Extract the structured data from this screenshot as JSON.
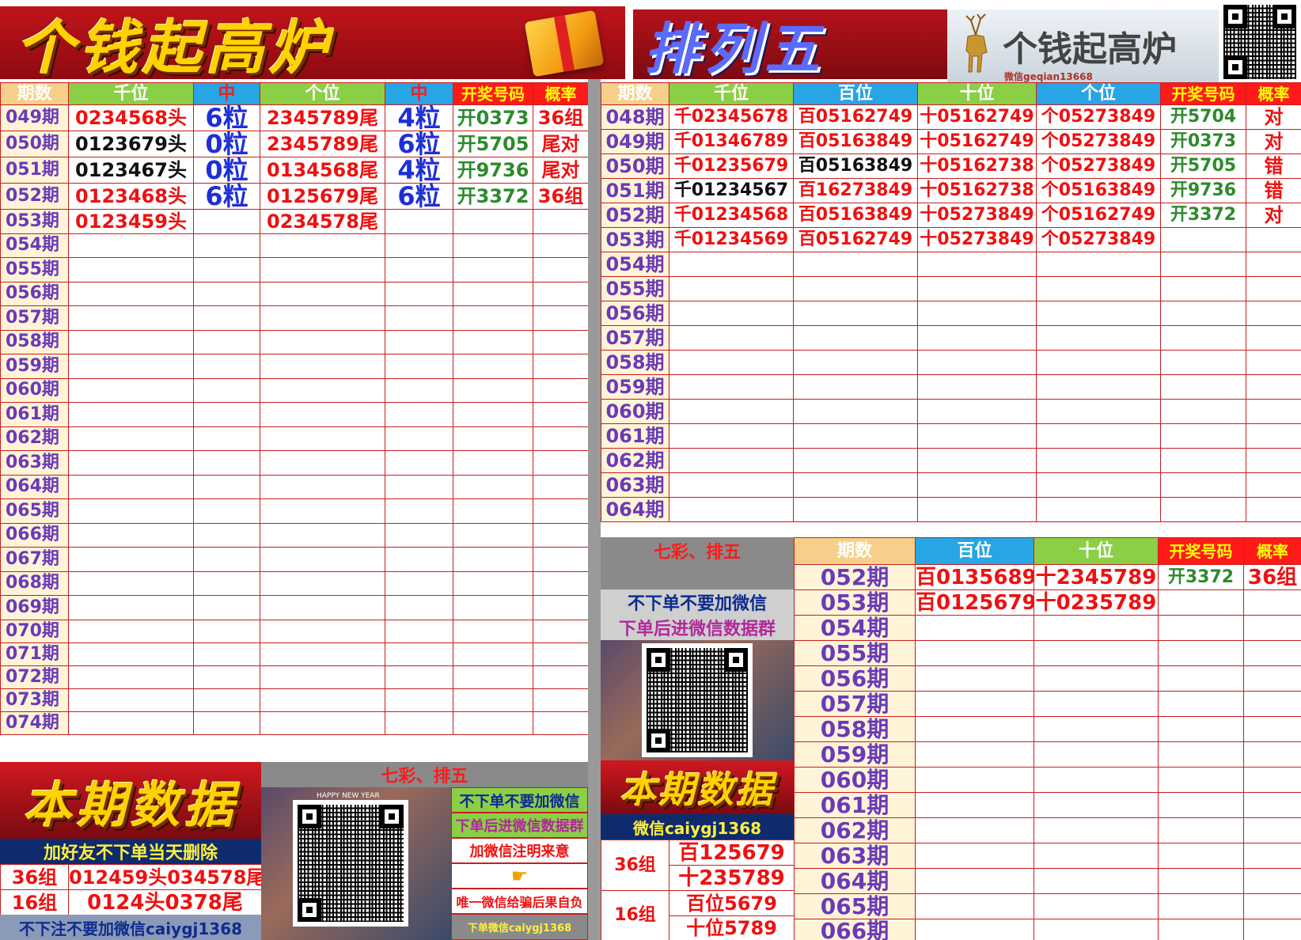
{
  "left_banner": {
    "title": "个钱起高炉"
  },
  "right_banner": {
    "title": "排列五",
    "logo_text": "个钱起高炉",
    "wechat_caption": "微信geqian13668"
  },
  "left_table": {
    "headers": [
      "期数",
      "千位",
      "中",
      "个位",
      "中",
      "开奖号码",
      "概率"
    ],
    "rows": [
      [
        "049期",
        "0234568头",
        "6粒",
        "2345789尾",
        "4粒",
        "开0373",
        "36组"
      ],
      [
        "050期",
        "0123679头",
        "0粒",
        "2345789尾",
        "6粒",
        "开5705",
        "尾对"
      ],
      [
        "051期",
        "0123467头",
        "0粒",
        "0134568尾",
        "4粒",
        "开9736",
        "尾对"
      ],
      [
        "052期",
        "0123468头",
        "6粒",
        "0125679尾",
        "6粒",
        "开3372",
        "36组"
      ],
      [
        "053期",
        "0123459头",
        "",
        "0234578尾",
        "",
        "",
        ""
      ],
      [
        "054期",
        "",
        "",
        "",
        "",
        "",
        ""
      ],
      [
        "055期",
        "",
        "",
        "",
        "",
        "",
        ""
      ],
      [
        "056期",
        "",
        "",
        "",
        "",
        "",
        ""
      ],
      [
        "057期",
        "",
        "",
        "",
        "",
        "",
        ""
      ],
      [
        "058期",
        "",
        "",
        "",
        "",
        "",
        ""
      ],
      [
        "059期",
        "",
        "",
        "",
        "",
        "",
        ""
      ],
      [
        "060期",
        "",
        "",
        "",
        "",
        "",
        ""
      ],
      [
        "061期",
        "",
        "",
        "",
        "",
        "",
        ""
      ],
      [
        "062期",
        "",
        "",
        "",
        "",
        "",
        ""
      ],
      [
        "063期",
        "",
        "",
        "",
        "",
        "",
        ""
      ],
      [
        "064期",
        "",
        "",
        "",
        "",
        "",
        ""
      ],
      [
        "065期",
        "",
        "",
        "",
        "",
        "",
        ""
      ],
      [
        "066期",
        "",
        "",
        "",
        "",
        "",
        ""
      ],
      [
        "067期",
        "",
        "",
        "",
        "",
        "",
        ""
      ],
      [
        "068期",
        "",
        "",
        "",
        "",
        "",
        ""
      ],
      [
        "069期",
        "",
        "",
        "",
        "",
        "",
        ""
      ],
      [
        "070期",
        "",
        "",
        "",
        "",
        "",
        ""
      ],
      [
        "071期",
        "",
        "",
        "",
        "",
        "",
        ""
      ],
      [
        "072期",
        "",
        "",
        "",
        "",
        "",
        ""
      ],
      [
        "073期",
        "",
        "",
        "",
        "",
        "",
        ""
      ],
      [
        "074期",
        "",
        "",
        "",
        "",
        "",
        ""
      ]
    ]
  },
  "right_table": {
    "headers": [
      "期数",
      "千位",
      "百位",
      "十位",
      "个位",
      "开奖号码",
      "概率"
    ],
    "rows": [
      [
        "048期",
        "千02345678",
        "百05162749",
        "十05162749",
        "个05273849",
        "开5704",
        "对"
      ],
      [
        "049期",
        "千01346789",
        "百05163849",
        "十05162749",
        "个05273849",
        "开0373",
        "对"
      ],
      [
        "050期",
        "千01235679",
        "百05163849",
        "十05162738",
        "个05273849",
        "开5705",
        "错"
      ],
      [
        "051期",
        "千01234567",
        "百16273849",
        "十05162738",
        "个05163849",
        "开9736",
        "错"
      ],
      [
        "052期",
        "千01234568",
        "百05163849",
        "十05273849",
        "个05162749",
        "开3372",
        "对"
      ],
      [
        "053期",
        "千01234569",
        "百05162749",
        "十05273849",
        "个05273849",
        "",
        ""
      ],
      [
        "054期",
        "",
        "",
        "",
        "",
        "",
        ""
      ],
      [
        "055期",
        "",
        "",
        "",
        "",
        "",
        ""
      ],
      [
        "056期",
        "",
        "",
        "",
        "",
        "",
        ""
      ],
      [
        "057期",
        "",
        "",
        "",
        "",
        "",
        ""
      ],
      [
        "058期",
        "",
        "",
        "",
        "",
        "",
        ""
      ],
      [
        "059期",
        "",
        "",
        "",
        "",
        "",
        ""
      ],
      [
        "060期",
        "",
        "",
        "",
        "",
        "",
        ""
      ],
      [
        "061期",
        "",
        "",
        "",
        "",
        "",
        ""
      ],
      [
        "062期",
        "",
        "",
        "",
        "",
        "",
        ""
      ],
      [
        "063期",
        "",
        "",
        "",
        "",
        "",
        ""
      ],
      [
        "064期",
        "",
        "",
        "",
        "",
        "",
        ""
      ]
    ]
  },
  "sub_table": {
    "side_header": "七彩、排五",
    "headers": [
      "期数",
      "百位",
      "十位",
      "开奖号码",
      "概率"
    ],
    "rows": [
      [
        "052期",
        "百0135689",
        "十2345789",
        "开3372",
        "36组"
      ],
      [
        "053期",
        "百0125679",
        "十0235789",
        "",
        ""
      ],
      [
        "054期",
        "",
        "",
        "",
        ""
      ],
      [
        "055期",
        "",
        "",
        "",
        ""
      ],
      [
        "056期",
        "",
        "",
        "",
        ""
      ],
      [
        "057期",
        "",
        "",
        "",
        ""
      ],
      [
        "058期",
        "",
        "",
        "",
        ""
      ],
      [
        "059期",
        "",
        "",
        "",
        ""
      ],
      [
        "060期",
        "",
        "",
        "",
        ""
      ],
      [
        "061期",
        "",
        "",
        "",
        ""
      ],
      [
        "062期",
        "",
        "",
        "",
        ""
      ],
      [
        "063期",
        "",
        "",
        "",
        ""
      ],
      [
        "064期",
        "",
        "",
        "",
        ""
      ],
      [
        "065期",
        "",
        "",
        "",
        ""
      ],
      [
        "066期",
        "",
        "",
        "",
        ""
      ]
    ],
    "notice_1": "不下单不要加微信",
    "notice_2": "下单后进微信数据群"
  },
  "left_bottom": {
    "banner_title": "本期数据",
    "notice": "加好友不下单当天删除",
    "rows": [
      {
        "label": "36组",
        "value": "012459头034578尾"
      },
      {
        "label": "16组",
        "value": "0124头0378尾"
      }
    ],
    "footer": "不下注不要加微信caiygj1368"
  },
  "middle_bottom": {
    "header": "七彩、排五",
    "line_1": "不下单不要加微信",
    "line_2": "下单后进微信数据群",
    "line_3": "加微信注明来意",
    "line_4": "唯一微信给骗后果自负",
    "line_5": "下单微信caiygj1368",
    "photo_caption": "HAPPY NEW YEAR"
  },
  "right_bottom": {
    "banner_title": "本期数据",
    "wechat": "微信caiygj1368",
    "groups": [
      {
        "label": "36组",
        "values": [
          "百125679",
          "十235789"
        ]
      },
      {
        "label": "16组",
        "values": [
          "百位5679",
          "十位5789"
        ]
      }
    ]
  },
  "colors": {
    "grid_red": "#c81e1e",
    "period_purple": "#6a3ab8",
    "banner_red": "#c0141a"
  }
}
